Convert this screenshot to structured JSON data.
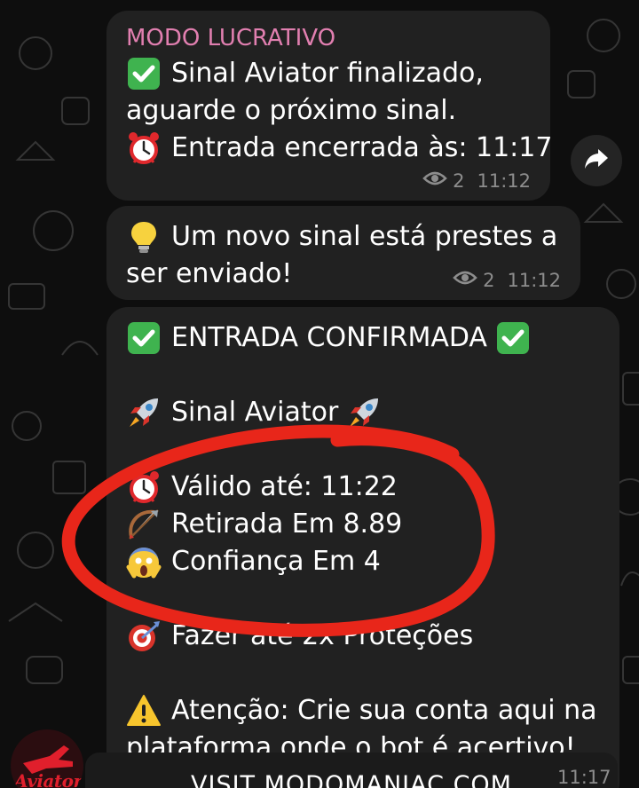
{
  "messages": [
    {
      "sender": "MODO LUCRATIVO",
      "lines": [
        {
          "emoji": "check-mark-icon",
          "text": "Sinal Aviator finalizado,"
        },
        {
          "emoji": "",
          "text": "aguarde o próximo sinal."
        },
        {
          "emoji": "alarm-clock-icon",
          "text": "Entrada encerrada às: 11:17"
        }
      ],
      "views": "2",
      "time": "11:12"
    },
    {
      "lines": [
        {
          "emoji": "light-bulb-icon",
          "text": "Um novo sinal está prestes a"
        },
        {
          "emoji": "",
          "text": "ser enviado!"
        }
      ],
      "views": "2",
      "time": "11:12"
    },
    {
      "lines": {
        "title": "ENTRADA CONFIRMADA",
        "signal": "Sinal Aviator",
        "valid_until": "Válido até: 11:22",
        "withdraw": "Retirada Em 8.89",
        "confidence": "Confiança Em 4",
        "protections": "Fazer até 2x Proteções",
        "warning_1": "Atenção: Crie sua conta aqui na",
        "warning_2": "plataforma onde o bot é acertivo!"
      },
      "time": "11:17"
    }
  ],
  "avatar": {
    "label": "Aviator"
  },
  "link_bar": {
    "text": "VISIT MODOMANIAC.COM"
  },
  "icons": {
    "forward": "forward-arrow-icon",
    "views": "eye-icon",
    "check": "check-mark-icon",
    "alarm": "alarm-clock-icon",
    "bulb": "light-bulb-icon",
    "rocket": "rocket-icon",
    "bow": "bow-and-arrow-icon",
    "scream": "screaming-face-icon",
    "target": "direct-hit-icon",
    "warning": "warning-icon"
  },
  "colors": {
    "background": "#0e0e0e",
    "bubble": "#212121",
    "sender": "#e17fb0",
    "meta": "#8d8d8d",
    "check": "#3fb34f",
    "annotation": "#e8261a"
  }
}
